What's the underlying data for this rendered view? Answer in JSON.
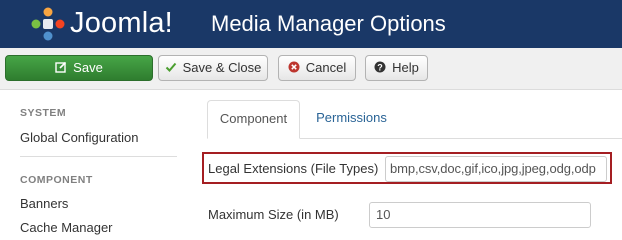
{
  "header": {
    "brand": "Joomla!",
    "title": "Media Manager Options",
    "colors": {
      "background": "#1a3867",
      "text": "#ffffff"
    }
  },
  "toolbar": {
    "save_label": "Save",
    "save_close_label": "Save & Close",
    "cancel_label": "Cancel",
    "help_label": "Help",
    "icons": [
      "edit-icon",
      "check-icon",
      "cancel-icon",
      "question-icon"
    ],
    "colors": {
      "save": "#46a546",
      "cancel_icon": "#bd362f"
    }
  },
  "sidebar": {
    "system_heading": "SYSTEM",
    "system_items": [
      "Global Configuration"
    ],
    "component_heading": "COMPONENT",
    "component_items": [
      "Banners",
      "Cache Manager"
    ]
  },
  "tabs": [
    "Component",
    "Permissions"
  ],
  "form": {
    "legal_extensions": {
      "label": "Legal Extensions (File Types)",
      "value": "bmp,csv,doc,gif,ico,jpg,jpeg,odg,odp"
    },
    "maximum_size": {
      "label": "Maximum Size (in MB)",
      "value": "10"
    },
    "highlight_color": "#a41e22"
  }
}
